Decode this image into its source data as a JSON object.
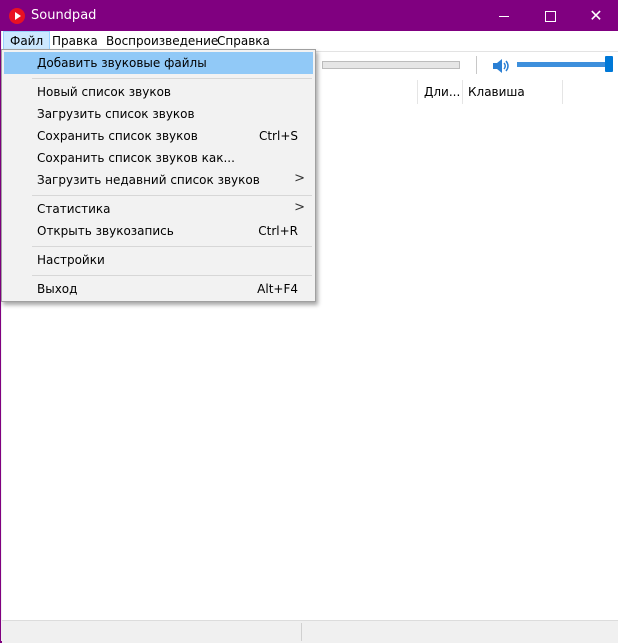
{
  "window": {
    "title": "Soundpad",
    "accent": "#800080"
  },
  "menubar": {
    "items": [
      {
        "label": "Файл"
      },
      {
        "label": "Правка"
      },
      {
        "label": "Воспроизведение"
      },
      {
        "label": "Справка"
      }
    ]
  },
  "list": {
    "columns": [
      {
        "label": "Дли..."
      },
      {
        "label": "Клавиша"
      }
    ]
  },
  "toolbar": {
    "volume_level": 1.0,
    "progress_level": 0
  },
  "file_menu": {
    "items": [
      {
        "label": "Добавить звуковые файлы",
        "shortcut": "",
        "submenu": false,
        "highlighted": true
      },
      {
        "label": "Новый список звуков",
        "shortcut": "",
        "submenu": false
      },
      {
        "label": "Загрузить список звуков",
        "shortcut": "",
        "submenu": false
      },
      {
        "label": "Сохранить список звуков",
        "shortcut": "Ctrl+S",
        "submenu": false
      },
      {
        "label": "Сохранить список звуков как...",
        "shortcut": "",
        "submenu": false
      },
      {
        "label": "Загрузить недавний список звуков",
        "shortcut": "",
        "submenu": true
      },
      {
        "label": "Статистика",
        "shortcut": "",
        "submenu": true
      },
      {
        "label": "Открыть звукозапись",
        "shortcut": "Ctrl+R",
        "submenu": false
      },
      {
        "label": "Настройки",
        "shortcut": "",
        "submenu": false
      },
      {
        "label": "Выход",
        "shortcut": "Alt+F4",
        "submenu": false
      }
    ],
    "submenu_arrow": ">"
  },
  "icons": {
    "app": "soundpad-play-icon",
    "speaker": "speaker-icon",
    "close": "close-icon",
    "minimize": "minimize-icon",
    "maximize": "maximize-icon"
  }
}
